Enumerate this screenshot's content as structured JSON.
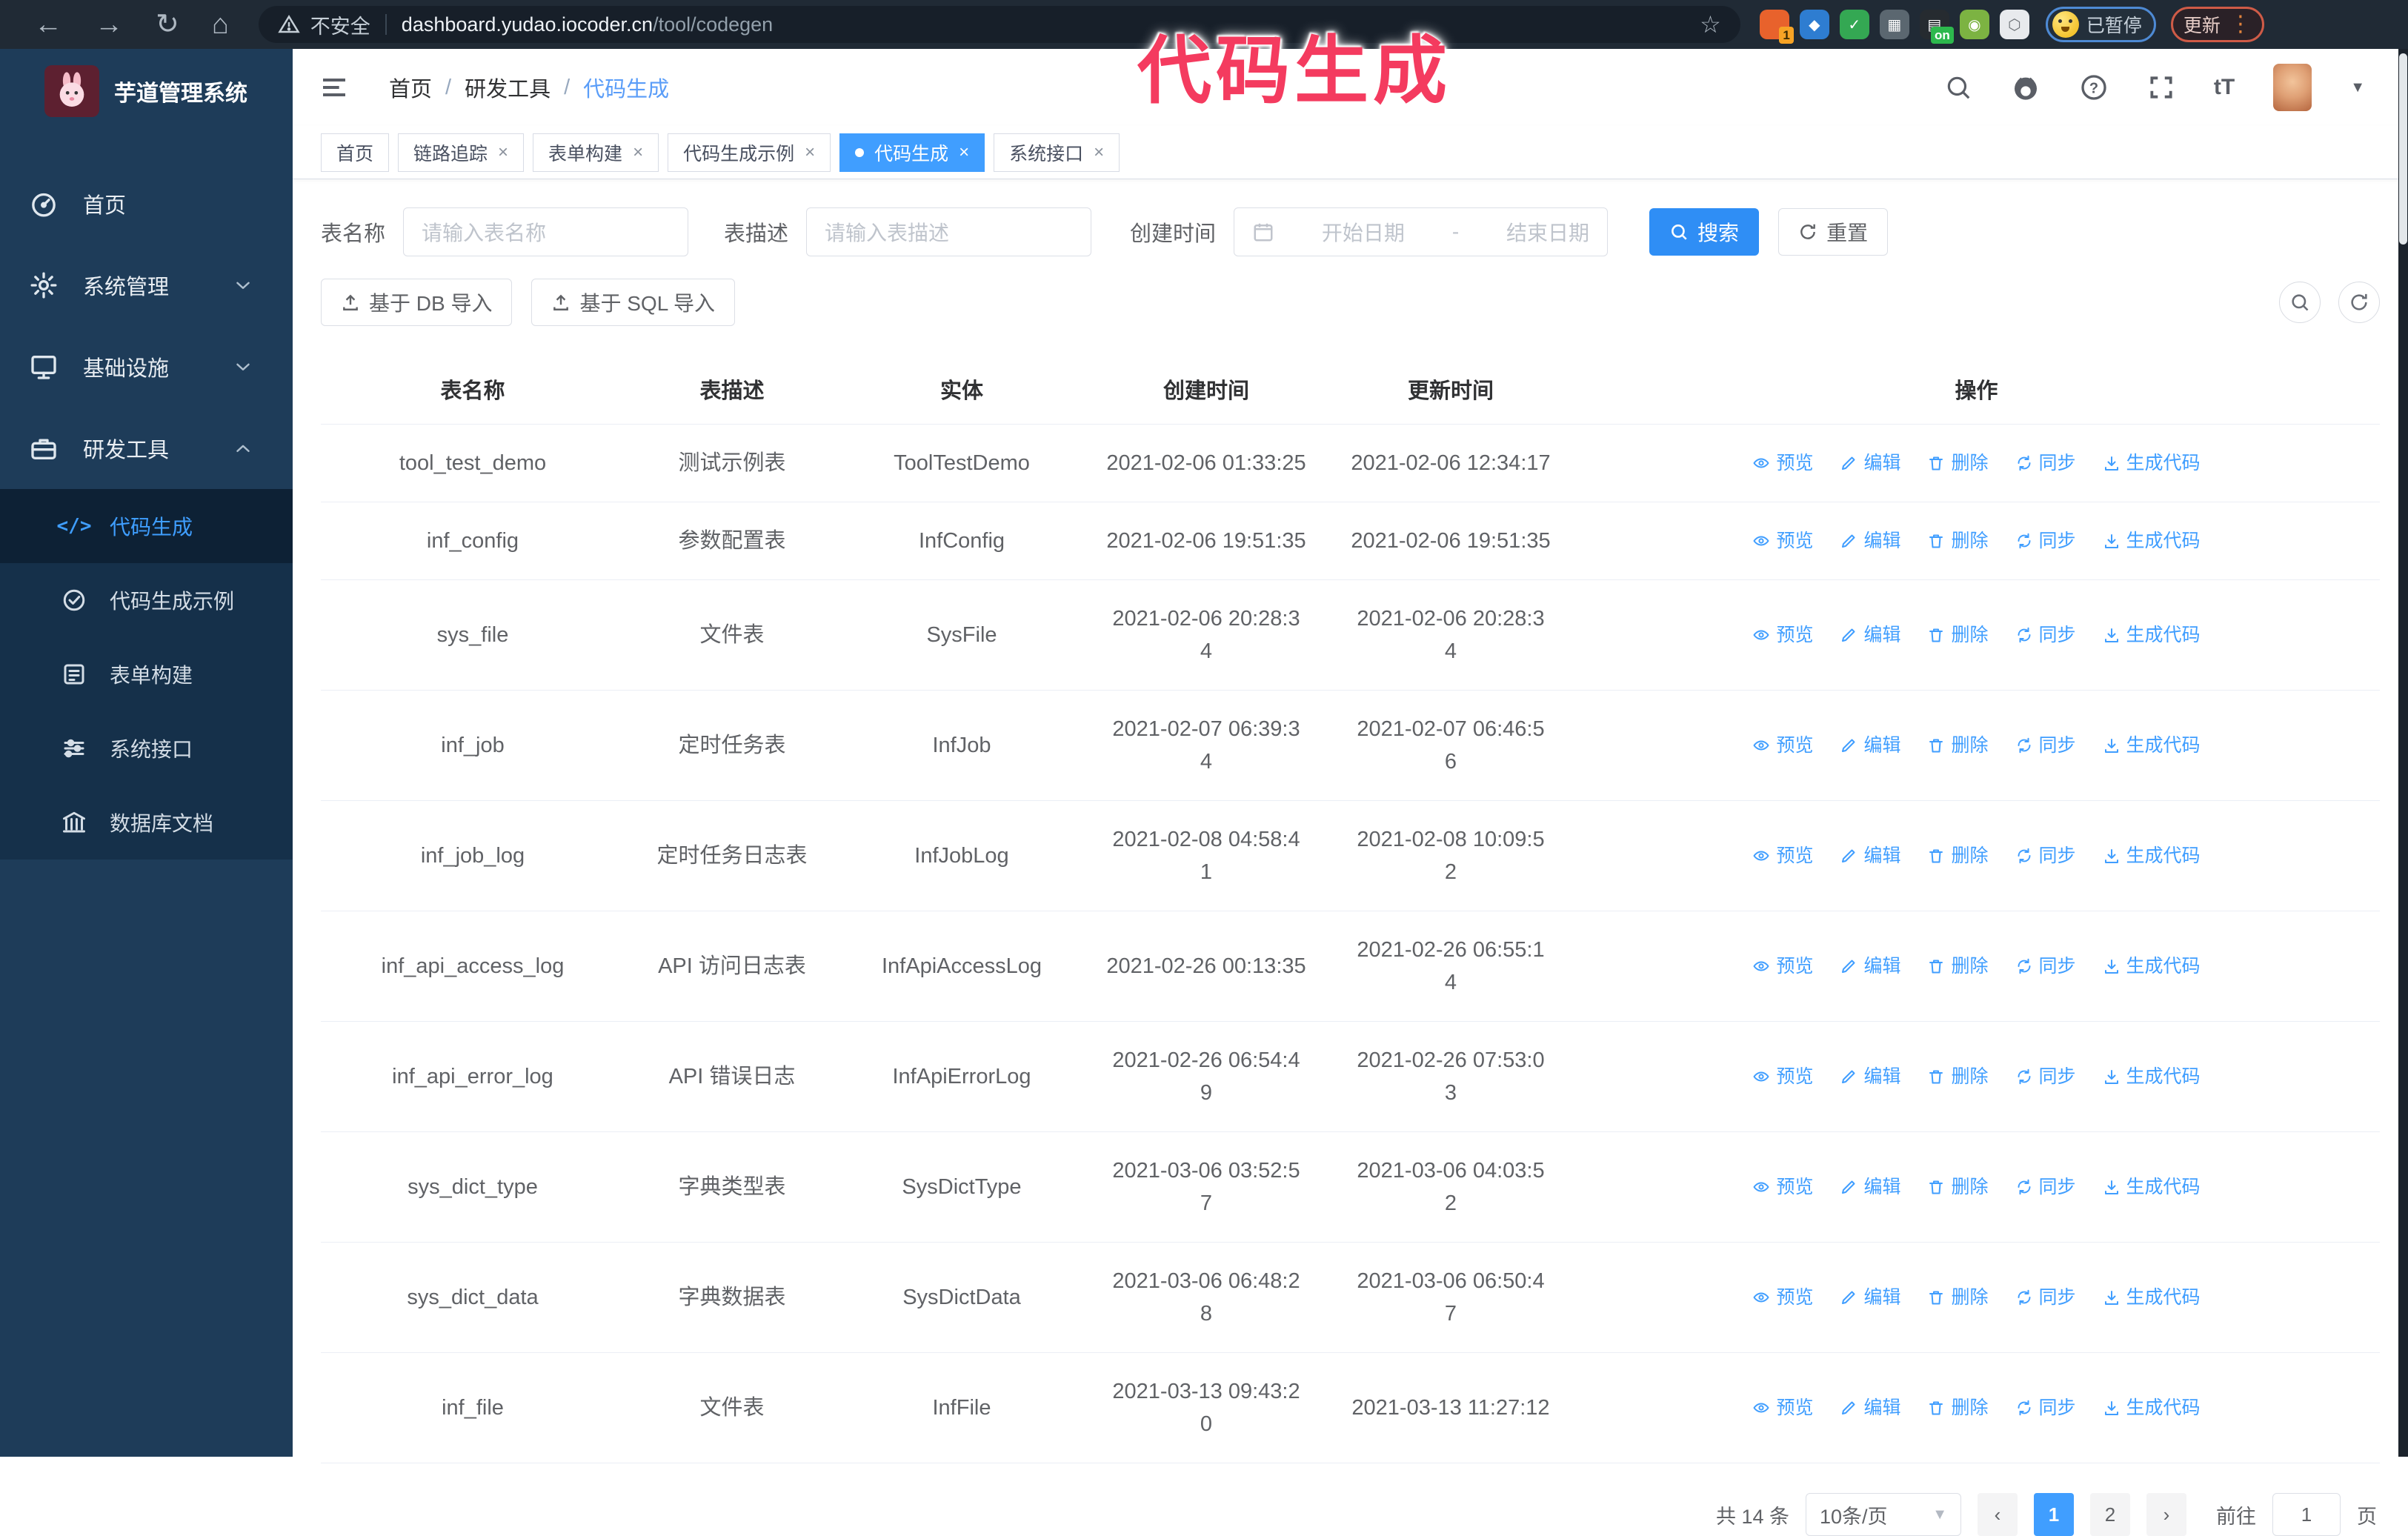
{
  "browser": {
    "security_label": "不安全",
    "url_host": "dashboard.yudao.iocoder.cn",
    "url_path": "/tool/codegen",
    "paused_badge": "已暂停",
    "update_button": "更新",
    "extensions": [
      {
        "name": "orange-circle-extension-icon",
        "badge": "1",
        "bg": "#e8622c",
        "glyph": ""
      },
      {
        "name": "blue-gem-extension-icon",
        "badge": "",
        "bg": "#2e7dd1",
        "glyph": "◆"
      },
      {
        "name": "green-check-extension-icon",
        "badge": "",
        "bg": "#34a853",
        "glyph": "✓"
      },
      {
        "name": "grid-extension-icon",
        "badge": "",
        "bg": "#5b6770",
        "glyph": "▦"
      },
      {
        "name": "dark-on-extension-icon",
        "badge": "on",
        "bg": "#262b30",
        "glyph": "▤"
      },
      {
        "name": "green-robot-extension-icon",
        "badge": "",
        "bg": "#7cb342",
        "glyph": "◉"
      },
      {
        "name": "puzzle-extension-icon",
        "badge": "",
        "bg": "#e8eaed",
        "glyph": "⬡"
      }
    ]
  },
  "annotation": {
    "text": "代码生成"
  },
  "sidebar": {
    "title": "芋道管理系统",
    "items": [
      {
        "label": "首页",
        "icon": "dashboard-icon"
      },
      {
        "label": "系统管理",
        "icon": "gear-icon",
        "chevron": "down"
      },
      {
        "label": "基础设施",
        "icon": "monitor-icon",
        "chevron": "down"
      },
      {
        "label": "研发工具",
        "icon": "toolbox-icon",
        "chevron": "up",
        "expanded": true
      }
    ],
    "submenu": [
      {
        "label": "代码生成",
        "icon": "code-icon",
        "active": true
      },
      {
        "label": "代码生成示例",
        "icon": "badge-check-icon"
      },
      {
        "label": "表单构建",
        "icon": "form-icon"
      },
      {
        "label": "系统接口",
        "icon": "sliders-icon"
      },
      {
        "label": "数据库文档",
        "icon": "database-doc-icon"
      }
    ]
  },
  "header": {
    "breadcrumb": [
      "首页",
      "研发工具",
      "代码生成"
    ]
  },
  "tabs": [
    {
      "label": "首页",
      "closable": false,
      "active": false
    },
    {
      "label": "链路追踪",
      "closable": true,
      "active": false
    },
    {
      "label": "表单构建",
      "closable": true,
      "active": false
    },
    {
      "label": "代码生成示例",
      "closable": true,
      "active": false
    },
    {
      "label": "代码生成",
      "closable": true,
      "active": true
    },
    {
      "label": "系统接口",
      "closable": true,
      "active": false
    }
  ],
  "search_form": {
    "table_name_label": "表名称",
    "table_name_placeholder": "请输入表名称",
    "table_desc_label": "表描述",
    "table_desc_placeholder": "请输入表描述",
    "create_time_label": "创建时间",
    "start_placeholder": "开始日期",
    "range_separator": "-",
    "end_placeholder": "结束日期",
    "search_button": "搜索",
    "reset_button": "重置"
  },
  "toolbar": {
    "import_db": "基于 DB 导入",
    "import_sql": "基于 SQL 导入"
  },
  "table": {
    "columns": [
      "表名称",
      "表描述",
      "实体",
      "创建时间",
      "更新时间",
      "操作"
    ],
    "actions": [
      "预览",
      "编辑",
      "删除",
      "同步",
      "生成代码"
    ],
    "rows": [
      {
        "name": "tool_test_demo",
        "desc": "测试示例表",
        "entity": "ToolTestDemo",
        "created": "2021-02-06 01:33:25",
        "updated": "2021-02-06 12:34:17"
      },
      {
        "name": "inf_config",
        "desc": "参数配置表",
        "entity": "InfConfig",
        "created": "2021-02-06 19:51:35",
        "updated": "2021-02-06 19:51:35"
      },
      {
        "name": "sys_file",
        "desc": "文件表",
        "entity": "SysFile",
        "created": "2021-02-06 20:28:3\n4",
        "updated": "2021-02-06 20:28:3\n4"
      },
      {
        "name": "inf_job",
        "desc": "定时任务表",
        "entity": "InfJob",
        "created": "2021-02-07 06:39:3\n4",
        "updated": "2021-02-07 06:46:5\n6"
      },
      {
        "name": "inf_job_log",
        "desc": "定时任务日志表",
        "entity": "InfJobLog",
        "created": "2021-02-08 04:58:4\n1",
        "updated": "2021-02-08 10:09:5\n2"
      },
      {
        "name": "inf_api_access_log",
        "desc": "API 访问日志表",
        "entity": "InfApiAccessLog",
        "created": "2021-02-26 00:13:35",
        "updated": "2021-02-26 06:55:1\n4"
      },
      {
        "name": "inf_api_error_log",
        "desc": "API 错误日志",
        "entity": "InfApiErrorLog",
        "created": "2021-02-26 06:54:4\n9",
        "updated": "2021-02-26 07:53:0\n3"
      },
      {
        "name": "sys_dict_type",
        "desc": "字典类型表",
        "entity": "SysDictType",
        "created": "2021-03-06 03:52:5\n7",
        "updated": "2021-03-06 04:03:5\n2"
      },
      {
        "name": "sys_dict_data",
        "desc": "字典数据表",
        "entity": "SysDictData",
        "created": "2021-03-06 06:48:2\n8",
        "updated": "2021-03-06 06:50:4\n7"
      },
      {
        "name": "inf_file",
        "desc": "文件表",
        "entity": "InfFile",
        "created": "2021-03-13 09:43:2\n0",
        "updated": "2021-03-13 11:27:12"
      }
    ]
  },
  "pagination": {
    "total": "共 14 条",
    "page_size": "10条/页",
    "pages": [
      "1",
      "2"
    ],
    "active_page": "1",
    "goto_label": "前往",
    "goto_value": "1",
    "page_suffix": "页"
  },
  "colors": {
    "accent": "#409eff",
    "annotation": "#f43b5f",
    "sidebar": "#1e3c59"
  }
}
